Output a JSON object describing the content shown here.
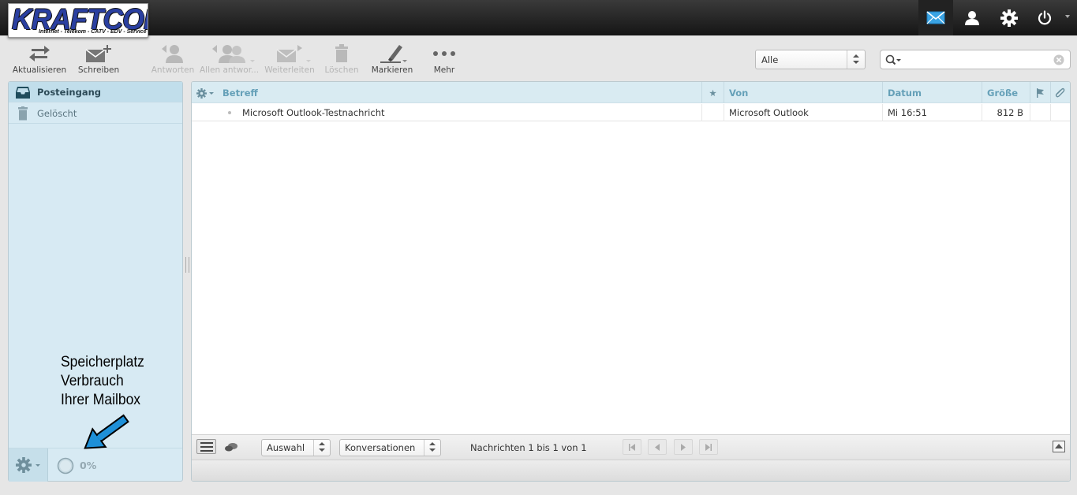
{
  "app": {
    "logo_text": "KRAFTCOM",
    "logo_tagline": "Internet - Telekom - CATV - EDV - Service"
  },
  "topnav": {
    "items": [
      "mail-icon",
      "contacts-icon",
      "settings-icon",
      "logout-icon"
    ],
    "accent": "#3aa3e3"
  },
  "toolbar": {
    "refresh": "Aktualisieren",
    "compose": "Schreiben",
    "reply": "Antworten",
    "reply_all": "Allen antwor...",
    "forward": "Weiterleiten",
    "delete": "Löschen",
    "mark": "Markieren",
    "more": "Mehr"
  },
  "filter": {
    "selected": "Alle"
  },
  "search": {
    "value": "",
    "placeholder": ""
  },
  "folders": [
    {
      "name": "Posteingang",
      "icon": "inbox-icon",
      "selected": true
    },
    {
      "name": "Gelöscht",
      "icon": "trash-icon",
      "selected": false
    }
  ],
  "annotation": {
    "text": "Speicherplatz\nVerbrauch\nIhrer Mailbox"
  },
  "quota": {
    "percent_label": "0%",
    "percent": 0
  },
  "columns": {
    "subject": "Betreff",
    "from": "Von",
    "date": "Datum",
    "size": "Größe"
  },
  "messages": [
    {
      "subject": "Microsoft Outlook-Testnachricht",
      "from": "Microsoft Outlook",
      "date": "Mi 16:51",
      "size": "812 B"
    }
  ],
  "list_footer": {
    "select_label": "Auswahl",
    "threads_label": "Konversationen",
    "count_text": "Nachrichten 1 bis 1 von 1"
  }
}
